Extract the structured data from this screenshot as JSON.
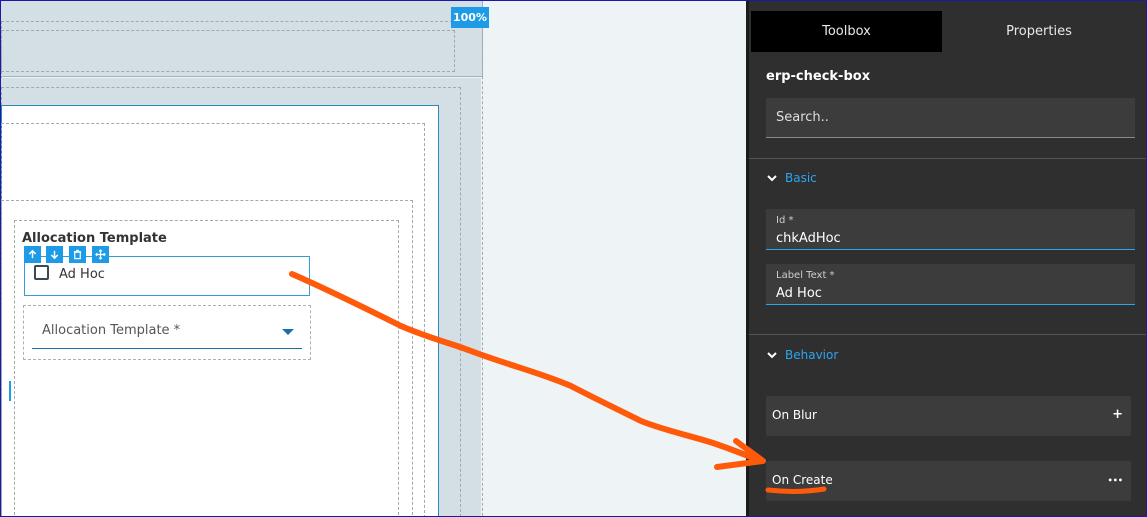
{
  "canvas": {
    "zoom": "100%",
    "section_title": "Allocation Template",
    "checkbox_label": "Ad Hoc",
    "checkbox_checked": false,
    "select_placeholder": "Allocation Template *",
    "toolbar_icons": [
      "arrow-up-icon",
      "arrow-down-icon",
      "trash-icon",
      "move-icon"
    ]
  },
  "panel": {
    "tabs": [
      {
        "label": "Toolbox",
        "active": true
      },
      {
        "label": "Properties",
        "active": false
      }
    ],
    "component_name": "erp-check-box",
    "search_placeholder": "Search..",
    "groups": {
      "basic": {
        "title": "Basic",
        "fields": [
          {
            "label": "Id *",
            "value": "chkAdHoc"
          },
          {
            "label": "Label Text *",
            "value": "Ad Hoc"
          }
        ]
      },
      "behavior": {
        "title": "Behavior",
        "events": [
          {
            "label": "On Blur",
            "action": "+"
          },
          {
            "label": "On Create",
            "action": "•••"
          }
        ]
      }
    }
  },
  "colors": {
    "accent_blue": "#1e9be6",
    "panel_bg": "#2f2f2f",
    "annotation_orange": "#ff5a0a"
  }
}
